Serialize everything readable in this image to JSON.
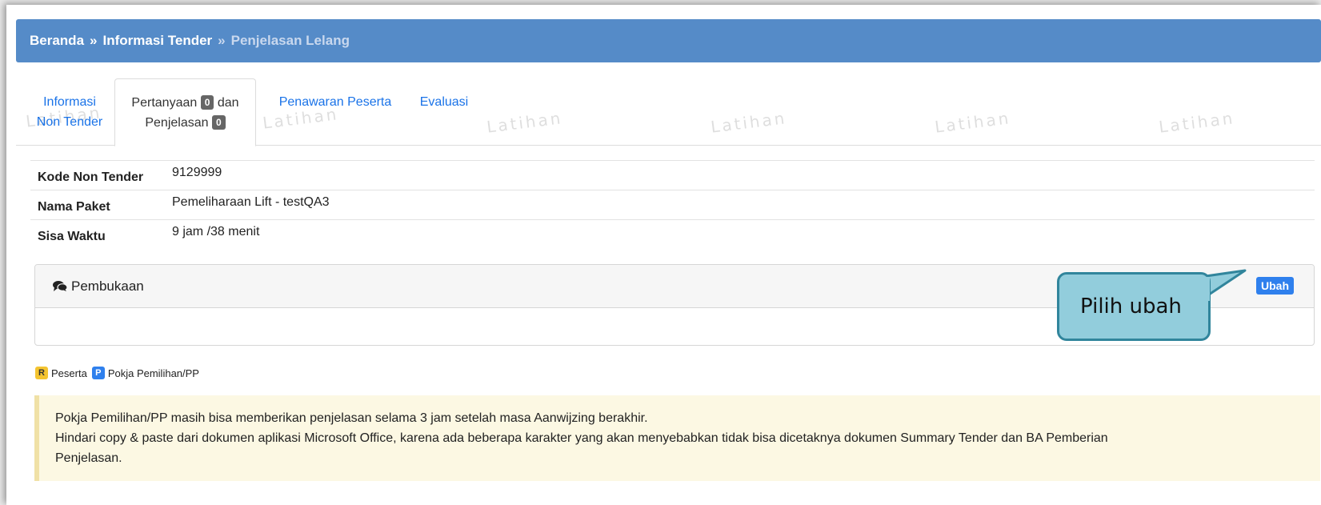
{
  "watermark": "Latihan",
  "breadcrumb": {
    "home": "Beranda",
    "separator": "»",
    "info": "Informasi Tender",
    "current": "Penjelasan Lelang"
  },
  "tabs": {
    "informasi_line1": "Informasi",
    "informasi_line2": "Non Tender",
    "pertanyaan_part1": "Pertanyaan",
    "pertanyaan_count": "0",
    "pertanyaan_part2": "dan",
    "penjelasan_label": "Penjelasan",
    "penjelasan_count": "0",
    "penawaran": "Penawaran Peserta",
    "evaluasi": "Evaluasi"
  },
  "info_rows": [
    {
      "label": "Kode Non Tender",
      "value": "9129999"
    },
    {
      "label": "Nama Paket",
      "value": "Pemeliharaan Lift - testQA3"
    },
    {
      "label": "Sisa Waktu",
      "value": "9 jam /38 menit"
    }
  ],
  "panel": {
    "icon": "comments-icon",
    "title": "Pembukaan",
    "button": "Ubah"
  },
  "legend": {
    "r_badge": "R",
    "r_label": "Peserta",
    "p_badge": "P",
    "p_label": "Pokja Pemilihan/PP"
  },
  "alert": {
    "line1": "Pokja Pemilihan/PP masih bisa memberikan penjelasan selama 3 jam setelah masa Aanwijzing berakhir.",
    "line2": "Hindari copy & paste dari dokumen aplikasi Microsoft Office, karena ada beberapa karakter yang akan menyebabkan tidak bisa dicetaknya dokumen Summary Tender dan BA Pemberian",
    "line3": "Penjelasan."
  },
  "callout": {
    "text": "Pilih ubah"
  },
  "colors": {
    "breadcrumb_bg": "#558bc8",
    "link": "#1a73e8",
    "button": "#2f80ed",
    "alert_bg": "#fcf8e3",
    "callout_bg": "#92cddc",
    "callout_border": "#31859c"
  }
}
